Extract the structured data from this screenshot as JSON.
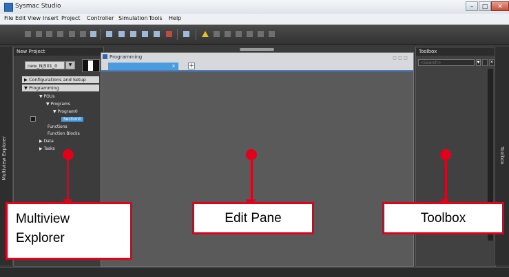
{
  "window": {
    "title": "Sysmac Studio",
    "buttons": {
      "minimize": "–",
      "maximize": "□",
      "close": "✕"
    }
  },
  "menu": [
    "File",
    "Edit",
    "View",
    "Insert",
    "Project",
    "Controller",
    "Simulation",
    "Tools",
    "Help"
  ],
  "explorer": {
    "side_tab": "Multiview Explorer",
    "header": "New Project",
    "device_value": "new_NJ501_0",
    "device_dropdown_arrow": "▼",
    "sections": [
      "▶ Configurations and Setup",
      "▼ Programming"
    ],
    "tree": {
      "pous": "▼ POUs",
      "programs": "▼ Programs",
      "program0": "▼ Program0",
      "section0": "Section0",
      "functions": "Functions",
      "function_blocks": "Function Blocks",
      "data": "▶ Data",
      "tasks": "▶ Tasks"
    }
  },
  "editor": {
    "title": "Programming",
    "tools": "◻ ◻ ◻",
    "tab_close": "×",
    "tab_add": "+"
  },
  "toolbox": {
    "header": "Toolbox",
    "search_placeholder": "<Search>",
    "search_arrow": "▼",
    "close_button": "✕",
    "side_tab": "Toolbox"
  },
  "callouts": {
    "explorer": "Multiview\nExplorer",
    "editor": "Edit Pane",
    "toolbox": "Toolbox"
  },
  "colors": {
    "accent": "#e0001b",
    "selection": "#4b9be0",
    "workspace": "#5a5a5a"
  }
}
